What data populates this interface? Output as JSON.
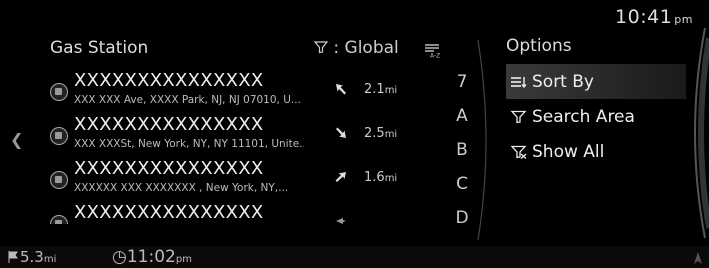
{
  "topbar": {
    "time": "10:41",
    "ampm": "pm"
  },
  "panel": {
    "title": "Gas Station",
    "filter_label": ": Global",
    "sort_icon": "sort-az-icon"
  },
  "results": [
    {
      "name": "XXXXXXXXXXXXXXX",
      "address": "XXX XXX Ave, XXXX Park, NJ, NJ 07010, U...",
      "direction": "northwest",
      "distance": "2.1",
      "unit": "mi"
    },
    {
      "name": "XXXXXXXXXXXXXXX",
      "address": "XXX XXXSt, New York, NY, NY 11101, Unite...",
      "direction": "southeast",
      "distance": "2.5",
      "unit": "mi"
    },
    {
      "name": "XXXXXXXXXXXXXXX",
      "address": "XXXXXX XXX XXXXXXX , New York, NY,...",
      "direction": "northeast",
      "distance": "1.6",
      "unit": "mi"
    },
    {
      "name": "XXXXXXXXXXXXXXX",
      "address": "",
      "direction": "east",
      "distance": "",
      "unit": ""
    }
  ],
  "alpha_index": [
    "7",
    "A",
    "B",
    "C",
    "D"
  ],
  "options": {
    "title": "Options",
    "items": [
      {
        "label": "Sort By",
        "icon": "sort-icon",
        "active": true
      },
      {
        "label": "Search Area",
        "icon": "funnel-icon",
        "active": false
      },
      {
        "label": "Show All",
        "icon": "funnel-clear-icon",
        "active": false
      }
    ]
  },
  "bottombar": {
    "distance": "5.3",
    "distance_unit": "mi",
    "eta": "11:02",
    "eta_ampm": "pm"
  }
}
